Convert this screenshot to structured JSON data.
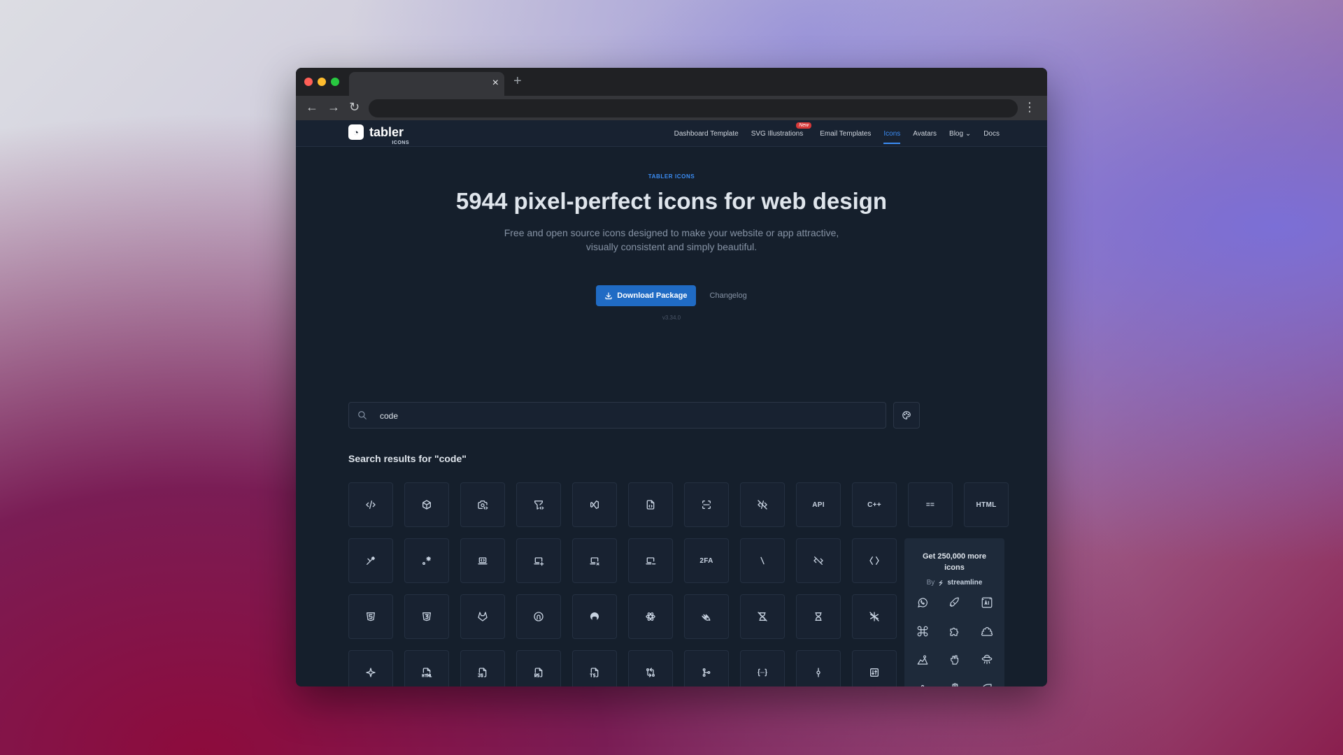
{
  "browser": {
    "new_tab_label": "+",
    "close_tab_label": "×"
  },
  "site": {
    "logo_text": "tabler",
    "logo_sub": "ICONS",
    "nav": [
      {
        "label": "Dashboard Template"
      },
      {
        "label": "SVG Illustrations",
        "badge": "New"
      },
      {
        "label": "Email Templates"
      },
      {
        "label": "Icons",
        "active": true
      },
      {
        "label": "Avatars"
      },
      {
        "label": "Blog ⌄"
      },
      {
        "label": "Docs"
      }
    ]
  },
  "hero": {
    "eyebrow": "TABLER ICONS",
    "headline": "5944 pixel-perfect icons for web design",
    "lead": "Free and open source icons designed to make your website or app attractive, visually consistent and simply beautiful.",
    "download_label": "Download Package",
    "changelog_label": "Changelog",
    "version": "v3.34.0"
  },
  "search": {
    "value": "code",
    "results_title": "Search results for \"code\""
  },
  "results": {
    "row1": [
      "code-icon",
      "box-icon",
      "camera-code-icon",
      "filter-code-icon",
      "brand-visual-studio-icon",
      "file-code-icon",
      "scan-code-icon",
      "code-off-icon",
      "API",
      "C++",
      "==",
      "HTML"
    ],
    "row2": [
      "code-asterisk-icon",
      "point-asterisk-icon",
      "device-laptop-code-icon",
      "laptop-plus-icon",
      "laptop-x-icon",
      "laptop-minus-icon",
      "2FA",
      "slash-icon",
      "code-off-alt-icon",
      "brackets-angle-icon"
    ],
    "row3": [
      "brand-html5-icon",
      "brand-css3-icon",
      "brand-gitlab-icon",
      "brand-codesandbox-icon",
      "brand-github-icon",
      "brand-react-icon",
      "brand-swift-icon",
      "hourglass-off-icon",
      "hourglass-icon",
      "asterisk-off-icon"
    ],
    "row4": [
      "sparkle-icon",
      "file-type-html-icon",
      "file-type-js-icon",
      "file-type-rs-icon",
      "file-type-ts-icon",
      "git-compare-icon",
      "git-merge-icon",
      "code-dots-icon",
      "git-commit-icon",
      "arrows-exchange-icon"
    ]
  },
  "promo": {
    "title": "Get 250,000 more icons",
    "by_label": "By",
    "brand": "streamline",
    "icons": [
      "whatsapp-icon",
      "rocket-icon",
      "image-ai-icon",
      "command-icon",
      "puzzle-icon",
      "poop-icon",
      "hiker-icon",
      "fist-icon",
      "ufo-icon",
      "graph-icon",
      "hand-icon",
      "leaf-icon"
    ]
  },
  "colors": {
    "accent": "#206bc4",
    "link_active": "#3b8df5",
    "page_bg": "#151f2c"
  }
}
